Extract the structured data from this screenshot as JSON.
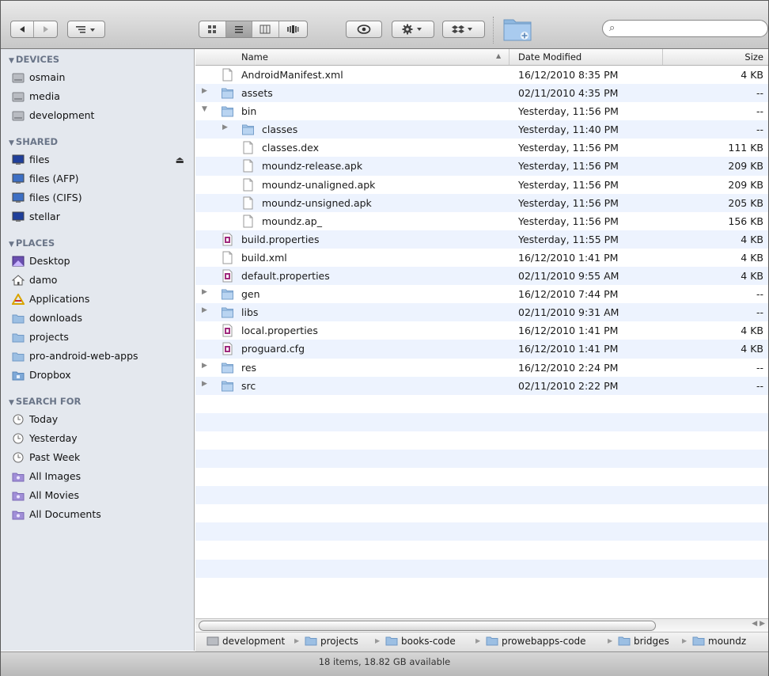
{
  "toolbar": {
    "search_placeholder": "",
    "search_glyph": "⌕"
  },
  "sidebar": {
    "sections": [
      {
        "title": "DEVICES",
        "items": [
          "osmain",
          "media",
          "development"
        ]
      },
      {
        "title": "SHARED",
        "items": [
          "files",
          "files (AFP)",
          "files (CIFS)",
          "stellar"
        ]
      },
      {
        "title": "PLACES",
        "items": [
          "Desktop",
          "damo",
          "Applications",
          "downloads",
          "projects",
          "pro-android-web-apps",
          "Dropbox"
        ]
      },
      {
        "title": "SEARCH FOR",
        "items": [
          "Today",
          "Yesterday",
          "Past Week",
          "All Images",
          "All Movies",
          "All Documents"
        ]
      }
    ]
  },
  "columns": {
    "name": "Name",
    "date": "Date Modified",
    "size": "Size"
  },
  "files": [
    {
      "name": "AndroidManifest.xml",
      "date": "16/12/2010 8:35 PM",
      "size": "4 KB"
    },
    {
      "name": "assets",
      "date": "02/11/2010 4:35 PM",
      "size": "--"
    },
    {
      "name": "bin",
      "date": "Yesterday, 11:56 PM",
      "size": "--"
    },
    {
      "name": "classes",
      "date": "Yesterday, 11:40 PM",
      "size": "--"
    },
    {
      "name": "classes.dex",
      "date": "Yesterday, 11:56 PM",
      "size": "111 KB"
    },
    {
      "name": "moundz-release.apk",
      "date": "Yesterday, 11:56 PM",
      "size": "209 KB"
    },
    {
      "name": "moundz-unaligned.apk",
      "date": "Yesterday, 11:56 PM",
      "size": "209 KB"
    },
    {
      "name": "moundz-unsigned.apk",
      "date": "Yesterday, 11:56 PM",
      "size": "205 KB"
    },
    {
      "name": "moundz.ap_",
      "date": "Yesterday, 11:56 PM",
      "size": "156 KB"
    },
    {
      "name": "build.properties",
      "date": "Yesterday, 11:55 PM",
      "size": "4 KB"
    },
    {
      "name": "build.xml",
      "date": "16/12/2010 1:41 PM",
      "size": "4 KB"
    },
    {
      "name": "default.properties",
      "date": "02/11/2010 9:55 AM",
      "size": "4 KB"
    },
    {
      "name": "gen",
      "date": "16/12/2010 7:44 PM",
      "size": "--"
    },
    {
      "name": "libs",
      "date": "02/11/2010 9:31 AM",
      "size": "--"
    },
    {
      "name": "local.properties",
      "date": "16/12/2010 1:41 PM",
      "size": "4 KB"
    },
    {
      "name": "proguard.cfg",
      "date": "16/12/2010 1:41 PM",
      "size": "4 KB"
    },
    {
      "name": "res",
      "date": "16/12/2010 2:24 PM",
      "size": "--"
    },
    {
      "name": "src",
      "date": "02/11/2010 2:22 PM",
      "size": "--"
    }
  ],
  "path": [
    "development",
    "projects",
    "books-code",
    "prowebapps-code",
    "bridges",
    "moundz"
  ],
  "status": "18 items, 18.82 GB available"
}
